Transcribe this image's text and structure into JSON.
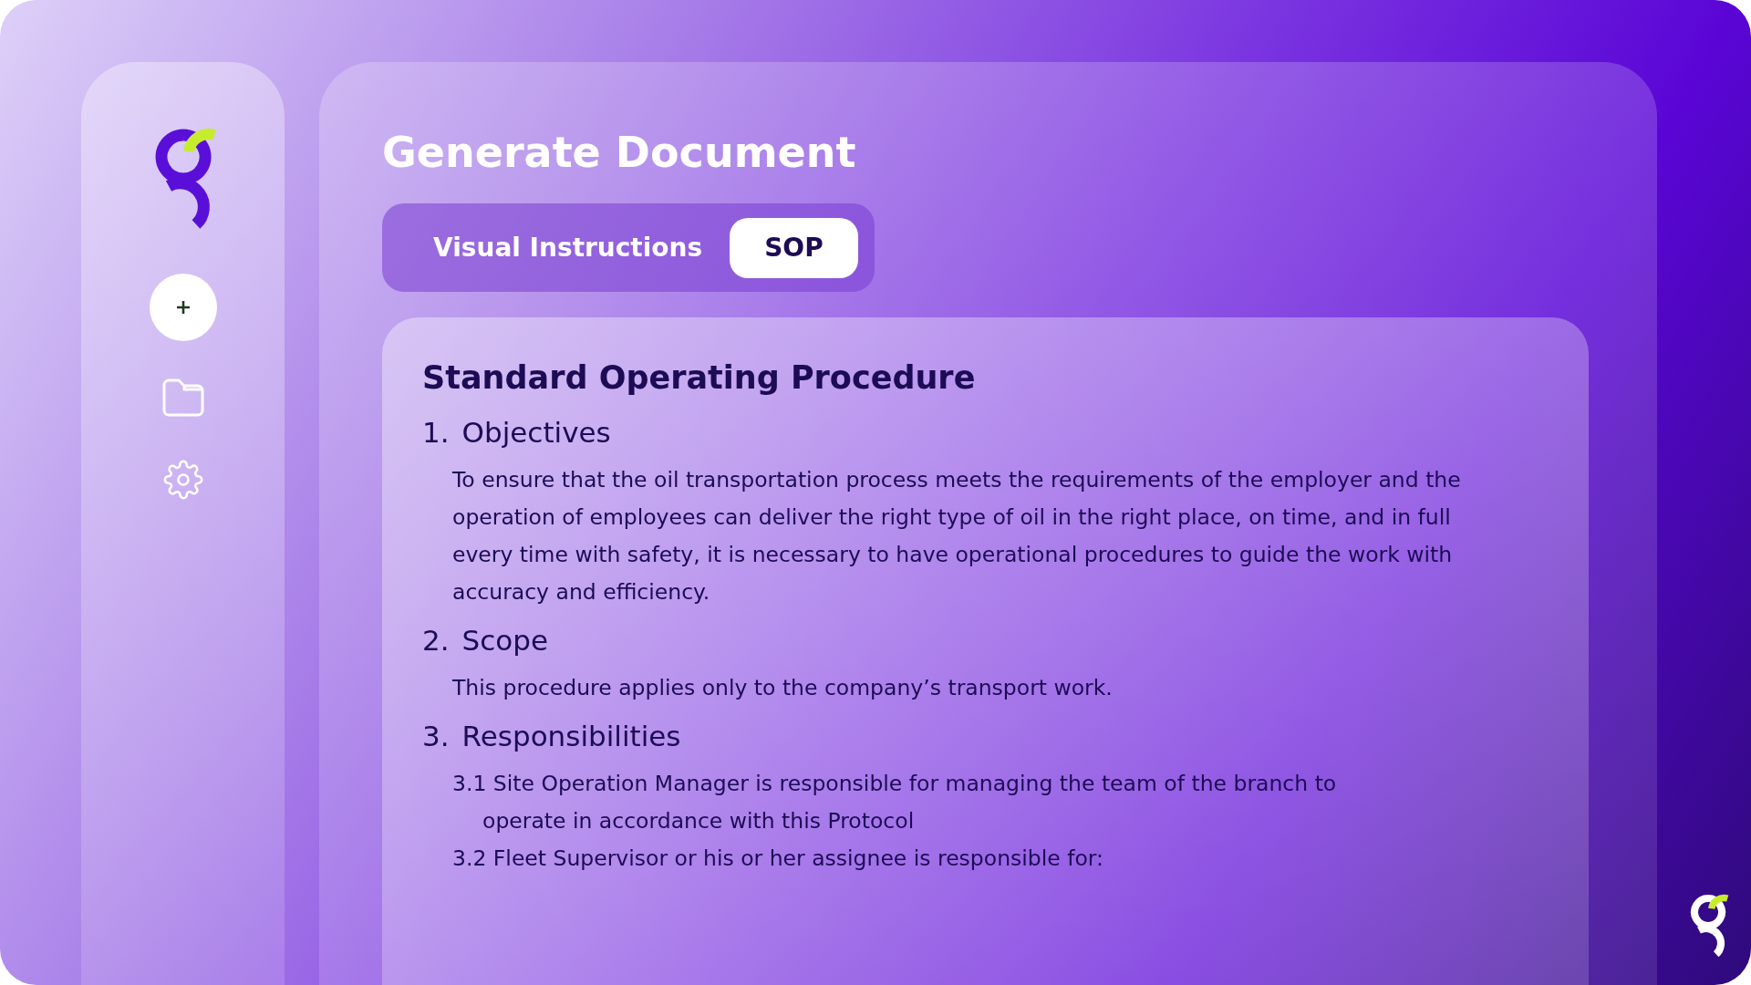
{
  "page": {
    "title": "Generate Document"
  },
  "tabs": [
    {
      "label": "Visual Instructions",
      "selected": false
    },
    {
      "label": "SOP",
      "selected": true
    }
  ],
  "document": {
    "title": "Standard Operating Procedure",
    "sections": [
      {
        "number": "1.",
        "title": "Objectives",
        "items": [
          {
            "kind": "paragraph",
            "text": "To ensure that the oil transportation process meets the requirements of the employer and the operation of employees can deliver the right type of oil in the right place, on time, and in full every time with safety, it is necessary to have operational procedures to guide the work with accuracy and efficiency."
          }
        ]
      },
      {
        "number": "2.",
        "title": "Scope",
        "items": [
          {
            "kind": "paragraph",
            "text": "This procedure applies only to the company’s transport work."
          }
        ]
      },
      {
        "number": "3.",
        "title": "Responsibilities",
        "items": [
          {
            "kind": "numbered",
            "text": "3.1 Site Operation Manager is responsible for managing the team of the branch to operate in accordance with this Protocol"
          },
          {
            "kind": "numbered",
            "text": "3.2 Fleet Supervisor or his or her assignee is responsible for:"
          }
        ]
      }
    ]
  }
}
